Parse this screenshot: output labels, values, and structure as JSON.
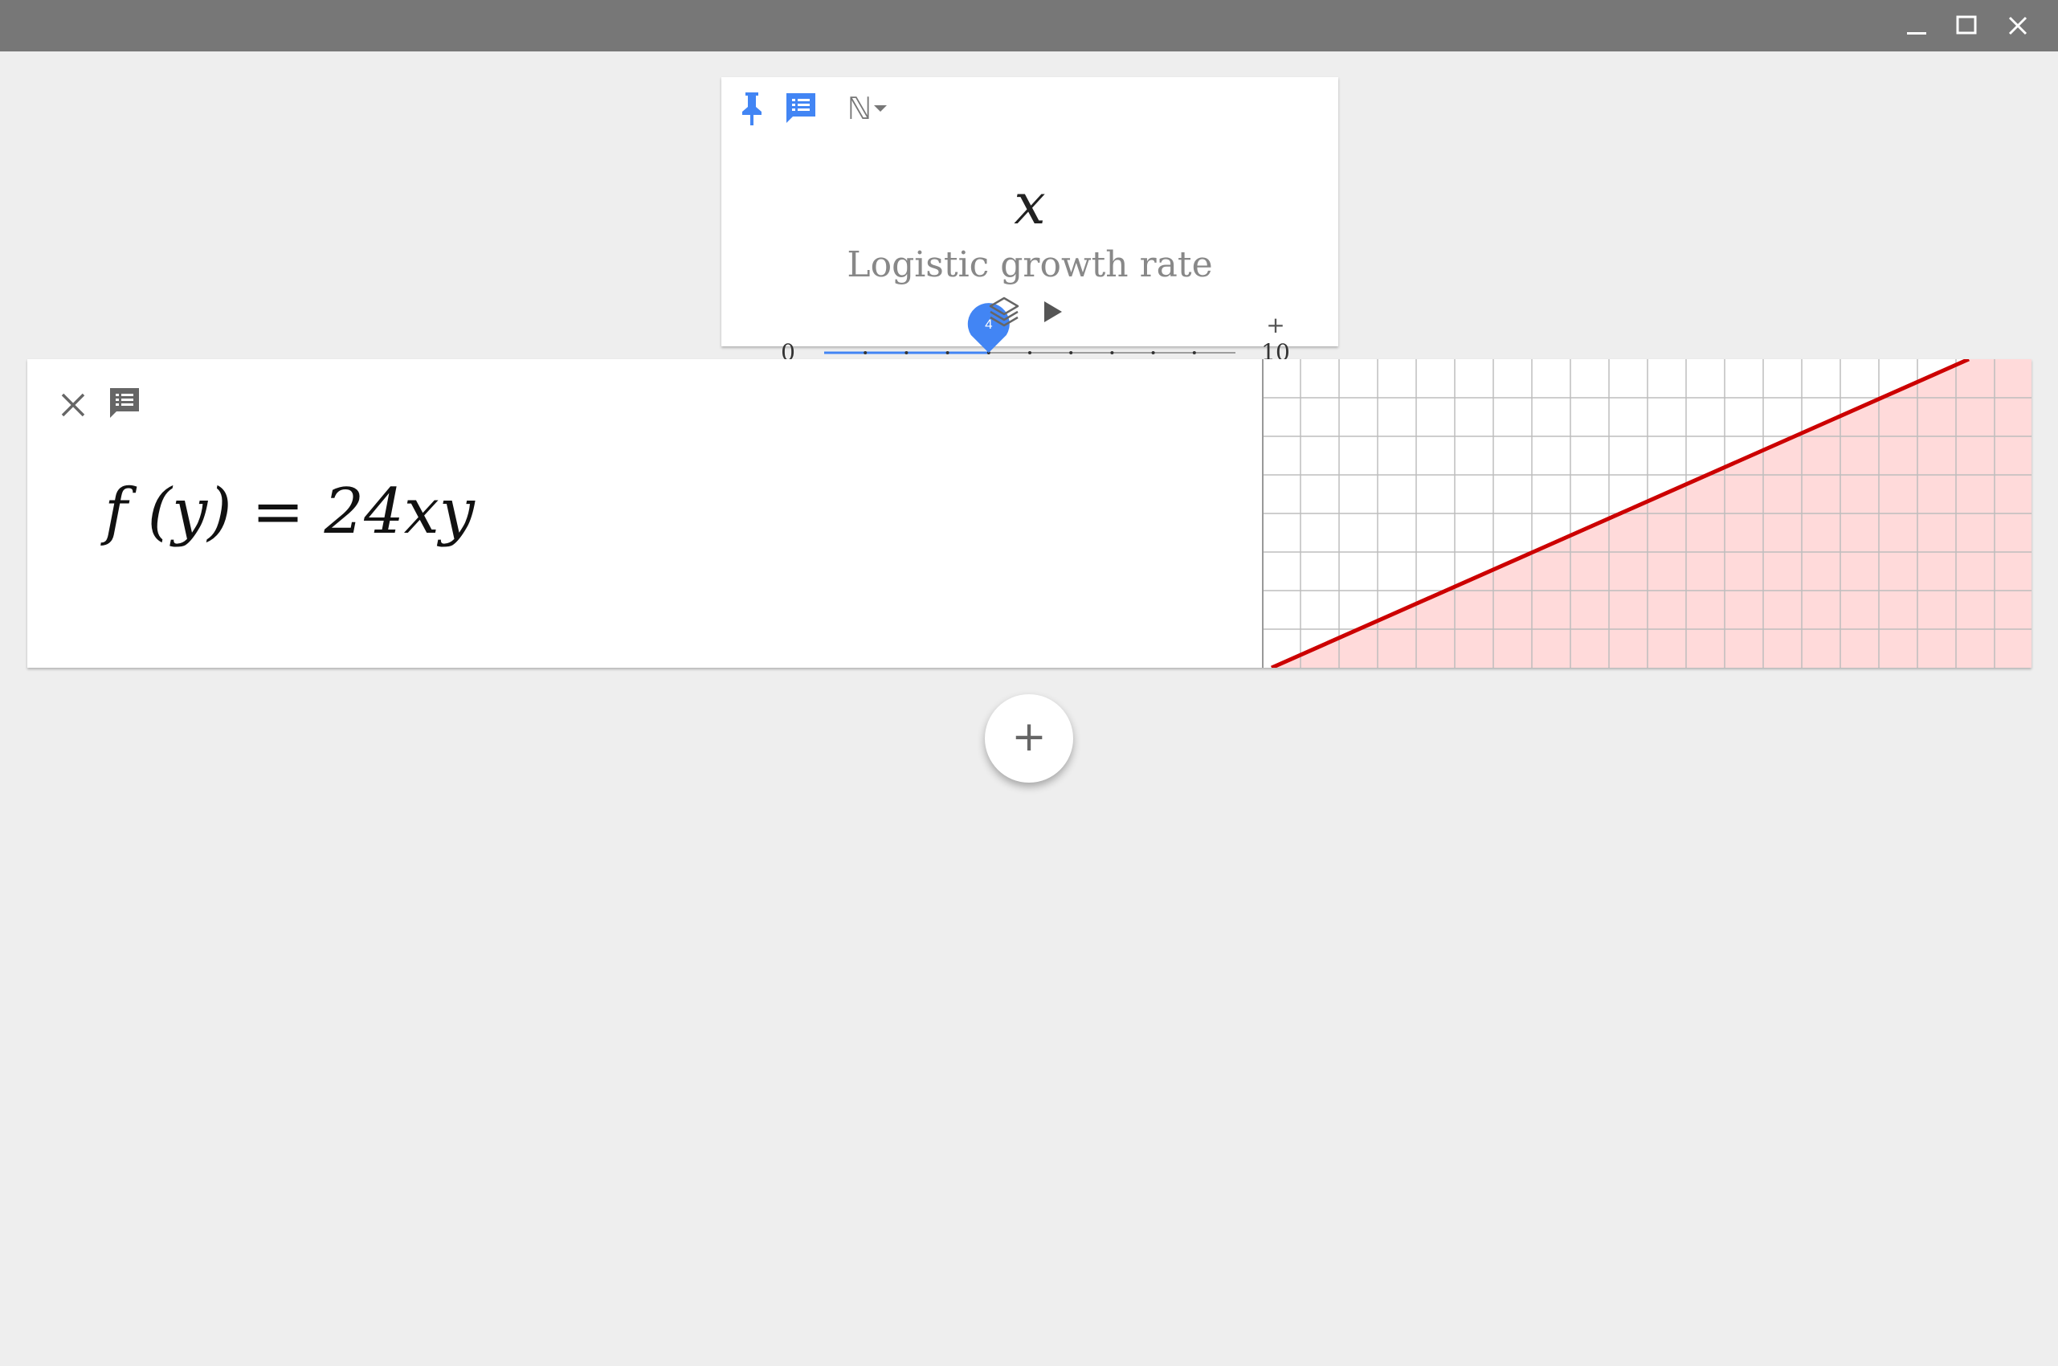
{
  "window": {
    "controls": [
      {
        "name": "minimize-icon"
      },
      {
        "name": "maximize-icon"
      },
      {
        "name": "close-icon"
      }
    ]
  },
  "slider_card": {
    "icons": [
      "pin-icon",
      "comment-icon"
    ],
    "number_set": "ℕ",
    "variable": "x",
    "description": "Logistic growth rate",
    "slider": {
      "min": "0",
      "max": "10",
      "value": 4,
      "value_label": "4",
      "plus_label": "+",
      "minus_label": "−",
      "accent_color": "#4285f4"
    },
    "bottom_icons": [
      "layers-icon",
      "play-icon"
    ]
  },
  "expression_card": {
    "icons": [
      "close-icon",
      "comment-icon"
    ],
    "expression": "f (y) = 24xy",
    "graph": {
      "line_color": "#cc0000",
      "fill_color": "#ffdada"
    }
  },
  "add_button": {
    "label": "+"
  }
}
